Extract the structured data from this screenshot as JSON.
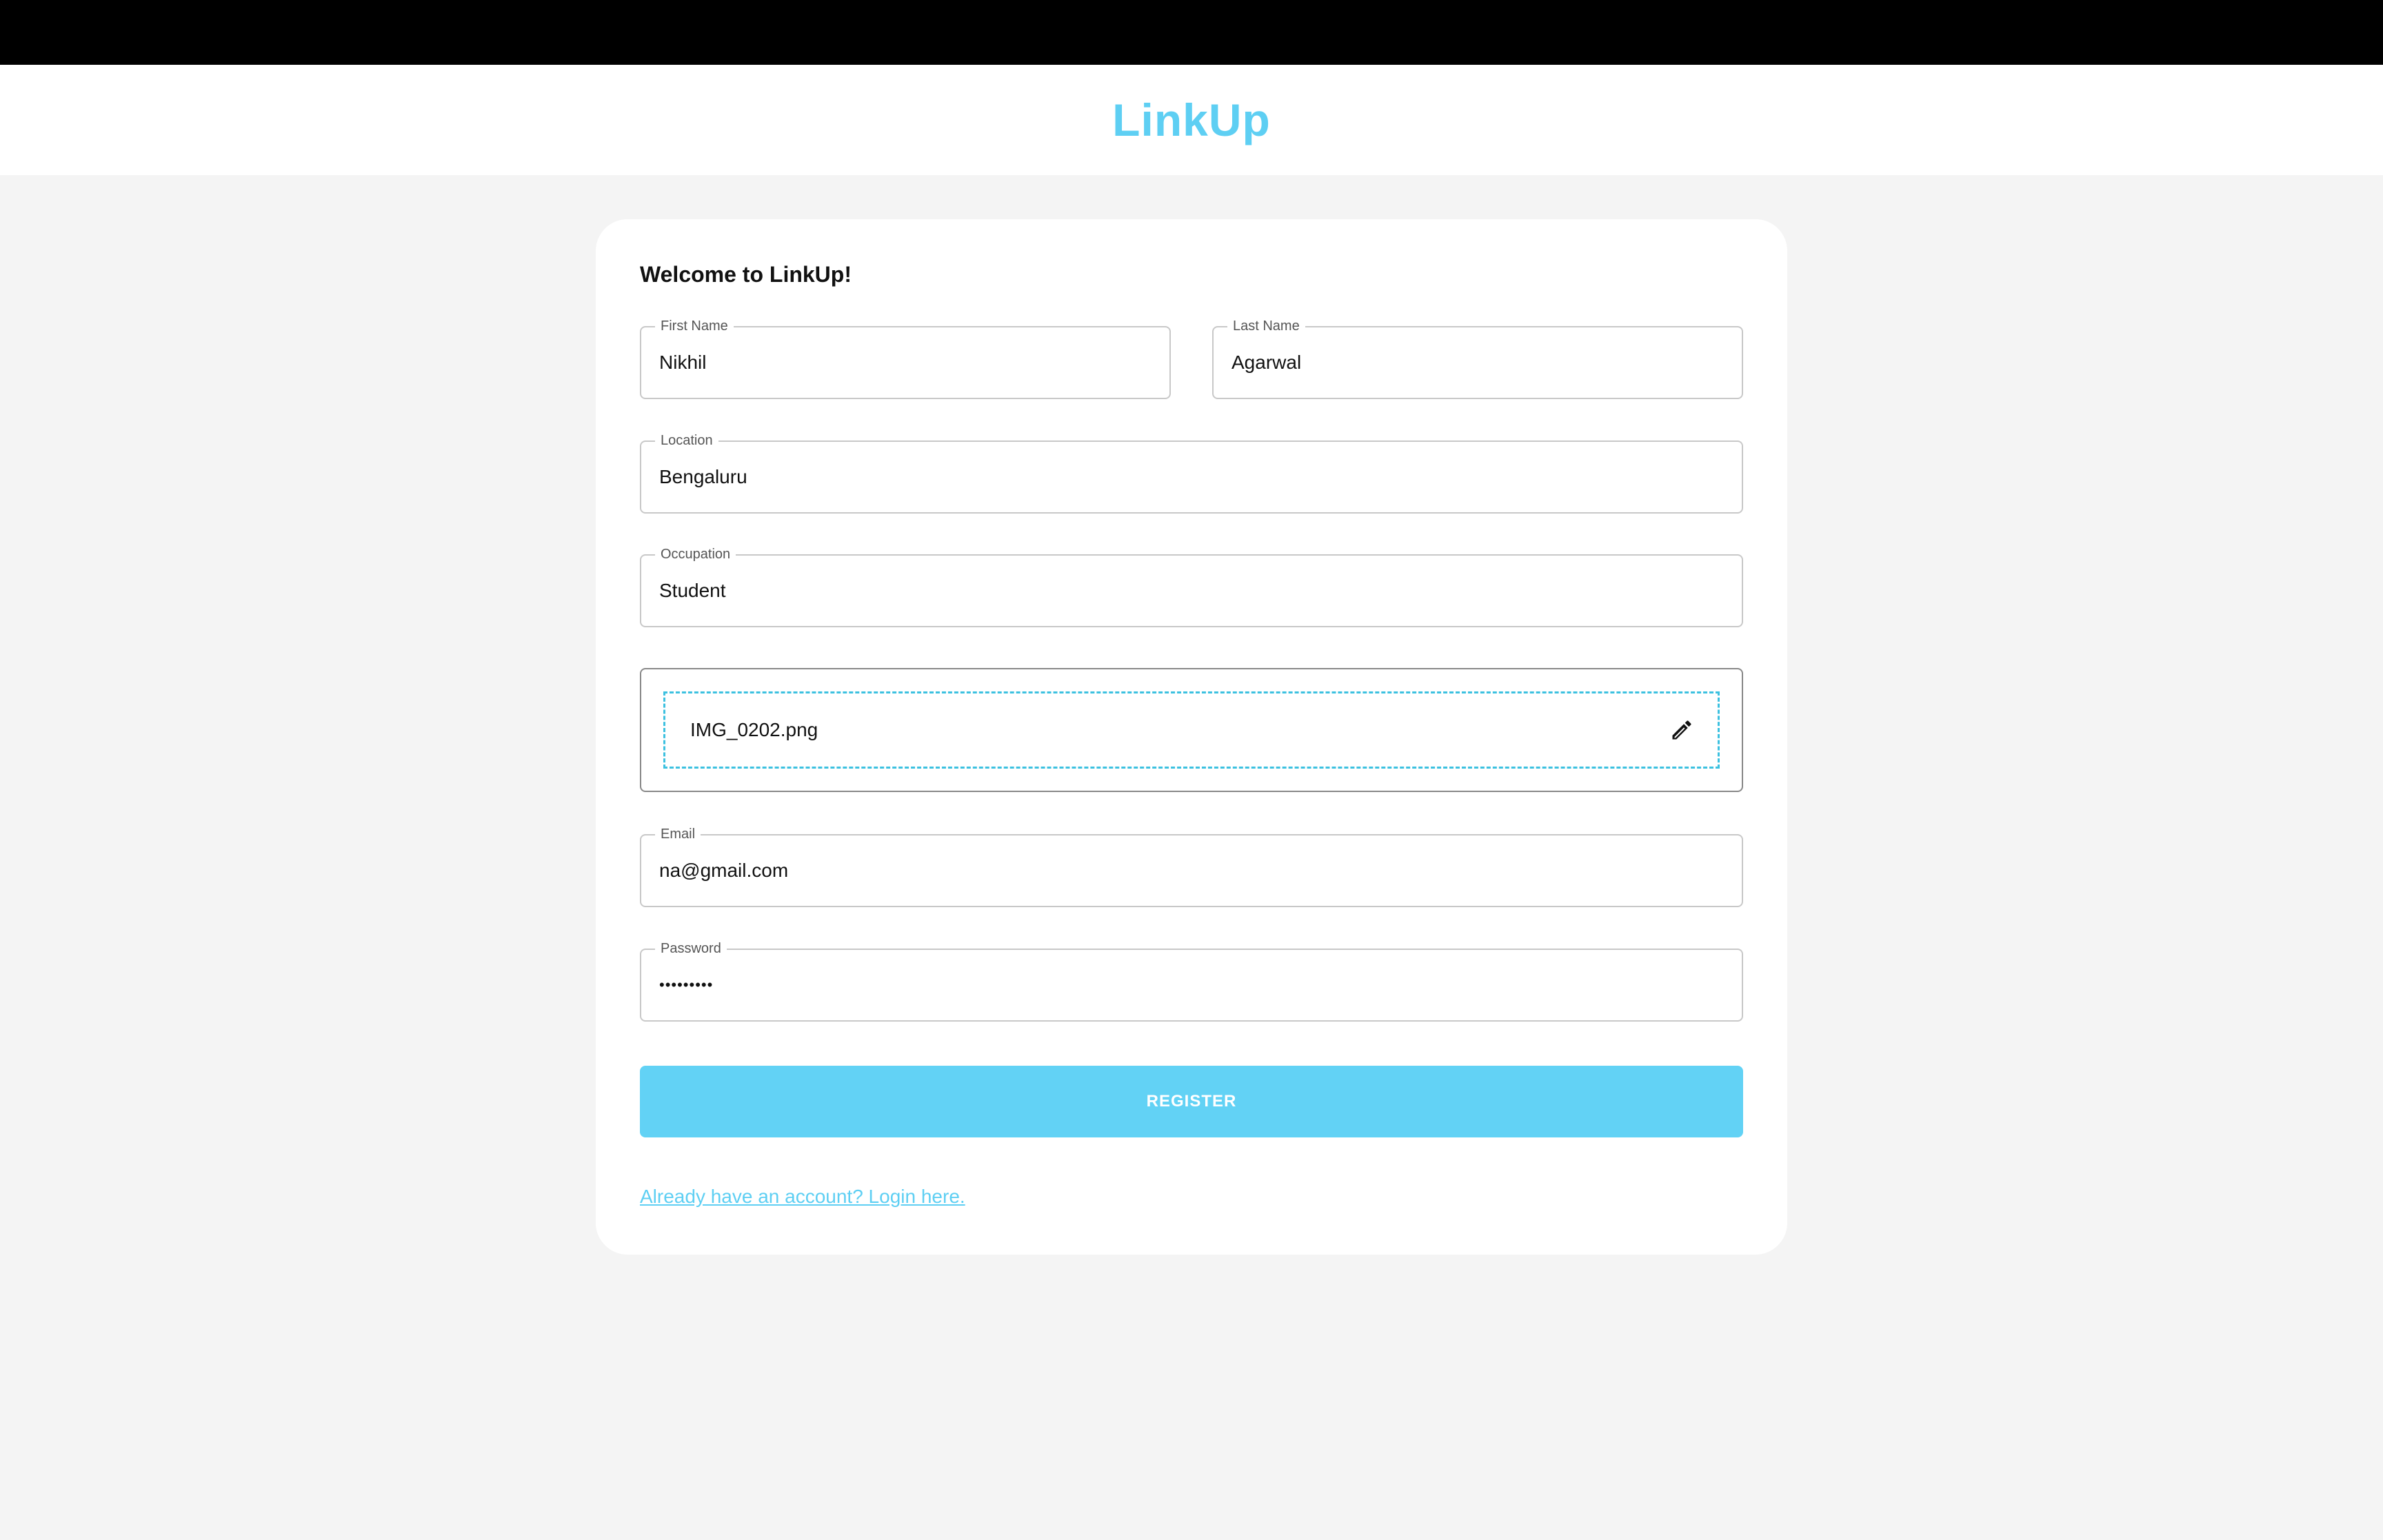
{
  "app": {
    "brand": "LinkUp"
  },
  "form": {
    "heading": "Welcome to LinkUp!",
    "first_name": {
      "label": "First Name",
      "value": "Nikhil"
    },
    "last_name": {
      "label": "Last Name",
      "value": "Agarwal"
    },
    "location": {
      "label": "Location",
      "value": "Bengaluru"
    },
    "occupation": {
      "label": "Occupation",
      "value": "Student"
    },
    "picture": {
      "filename": "IMG_0202.png",
      "icon": "pencil-edit-icon"
    },
    "email": {
      "label": "Email",
      "value": "na@gmail.com"
    },
    "password": {
      "label": "Password",
      "value": "•••••••••"
    },
    "register_label": "REGISTER",
    "login_link": "Already have an account? Login here."
  },
  "colors": {
    "accent": "#5ecff3",
    "button": "#62d2f5",
    "dropzone_border": "#3cc1e0",
    "background": "#f4f4f4"
  }
}
